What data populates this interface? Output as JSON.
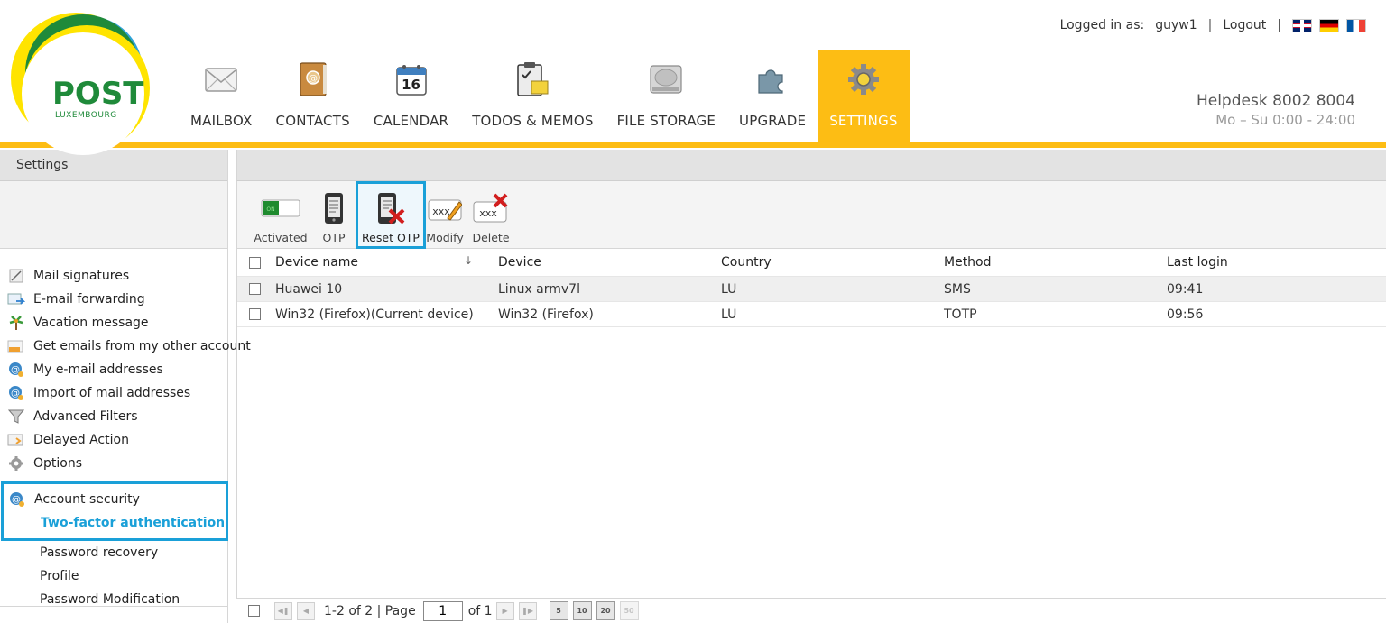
{
  "brand": {
    "word": "POST",
    "sub": "LUXEMBOURG"
  },
  "topbar": {
    "logged_in_label": "Logged in as:",
    "username": "guyw1",
    "logout": "Logout",
    "languages": [
      "en-flag-icon",
      "de-flag-icon",
      "fr-flag-icon"
    ]
  },
  "helpdesk": {
    "title": "Helpdesk 8002 8004",
    "hours": "Mo – Su 0:00 - 24:00"
  },
  "nav": {
    "mailbox": "MAILBOX",
    "contacts": "CONTACTS",
    "calendar": "CALENDAR",
    "calendar_day": "16",
    "todos": "TODOS & MEMOS",
    "storage": "FILE STORAGE",
    "upgrade": "UPGRADE",
    "settings": "SETTINGS"
  },
  "sidebar": {
    "title": "Settings",
    "items": [
      {
        "label": "Mail signatures",
        "icon": "signature-icon"
      },
      {
        "label": "E-mail forwarding",
        "icon": "forward-icon"
      },
      {
        "label": "Vacation message",
        "icon": "vacation-icon"
      },
      {
        "label": "Get emails from my other account",
        "icon": "pop-icon"
      },
      {
        "label": "My e-mail addresses",
        "icon": "addresses-icon"
      },
      {
        "label": "Import of mail addresses",
        "icon": "import-icon"
      },
      {
        "label": "Advanced Filters",
        "icon": "filter-icon"
      },
      {
        "label": "Delayed Action",
        "icon": "delayed-icon"
      },
      {
        "label": "Options",
        "icon": "gear-icon"
      }
    ],
    "security": {
      "label": "Account security",
      "current": "Two-factor authentication"
    },
    "sub_items": [
      "Password recovery",
      "Profile",
      "Password Modification"
    ]
  },
  "toolbar": {
    "activated": "Activated",
    "otp": "OTP",
    "reset_otp": "Reset OTP",
    "modify": "Modify",
    "delete": "Delete"
  },
  "table": {
    "columns": [
      "Device name",
      "Device",
      "Country",
      "Method",
      "Last login"
    ],
    "rows": [
      [
        "Huawei 10",
        "Linux armv7l",
        "LU",
        "SMS",
        "09:41"
      ],
      [
        "Win32 (Firefox)(Current device)",
        "Win32 (Firefox)",
        "LU",
        "TOTP",
        "09:56"
      ]
    ]
  },
  "pager": {
    "range": "1-2 of 2 | Page",
    "page": "1",
    "of": "of 1",
    "sizes": [
      "5",
      "10",
      "20",
      "50"
    ]
  },
  "colors": {
    "brand_yellow": "#fdbd14",
    "highlight_blue": "#1aa0d8",
    "brand_green": "#1f8a3a"
  }
}
